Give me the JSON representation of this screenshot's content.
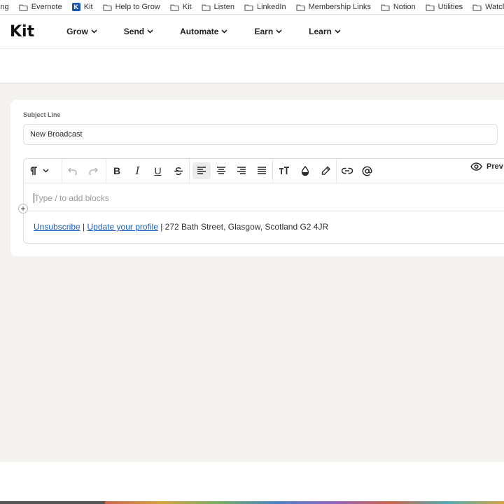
{
  "bookmarks": {
    "first": "ing",
    "items": [
      {
        "type": "folder",
        "label": "Evernote"
      },
      {
        "type": "kit",
        "label": "Kit"
      },
      {
        "type": "folder",
        "label": "Help to Grow"
      },
      {
        "type": "folder",
        "label": "Kit"
      },
      {
        "type": "folder",
        "label": "Listen"
      },
      {
        "type": "folder",
        "label": "LinkedIn"
      },
      {
        "type": "folder",
        "label": "Membership Links"
      },
      {
        "type": "folder",
        "label": "Notion"
      },
      {
        "type": "folder",
        "label": "Utilities"
      },
      {
        "type": "folder",
        "label": "Watch/Read L"
      }
    ]
  },
  "nav": {
    "logo": "Kit",
    "items": [
      "Grow",
      "Send",
      "Automate",
      "Earn",
      "Learn"
    ]
  },
  "form": {
    "subject_label": "Subject Line",
    "subject_value": "New Broadcast"
  },
  "editor": {
    "placeholder": "Type / to add blocks",
    "preview_label": "Prev",
    "footer": {
      "unsubscribe": "Unsubscribe",
      "sep1": " | ",
      "update_profile": "Update your profile",
      "address": " | 272 Bath Street, Glasgow, Scotland G2 4JR"
    }
  },
  "colors": {
    "link": "#1a5fb4",
    "background": "#f4f3f0",
    "favicon_kit": "#1b57a8"
  }
}
